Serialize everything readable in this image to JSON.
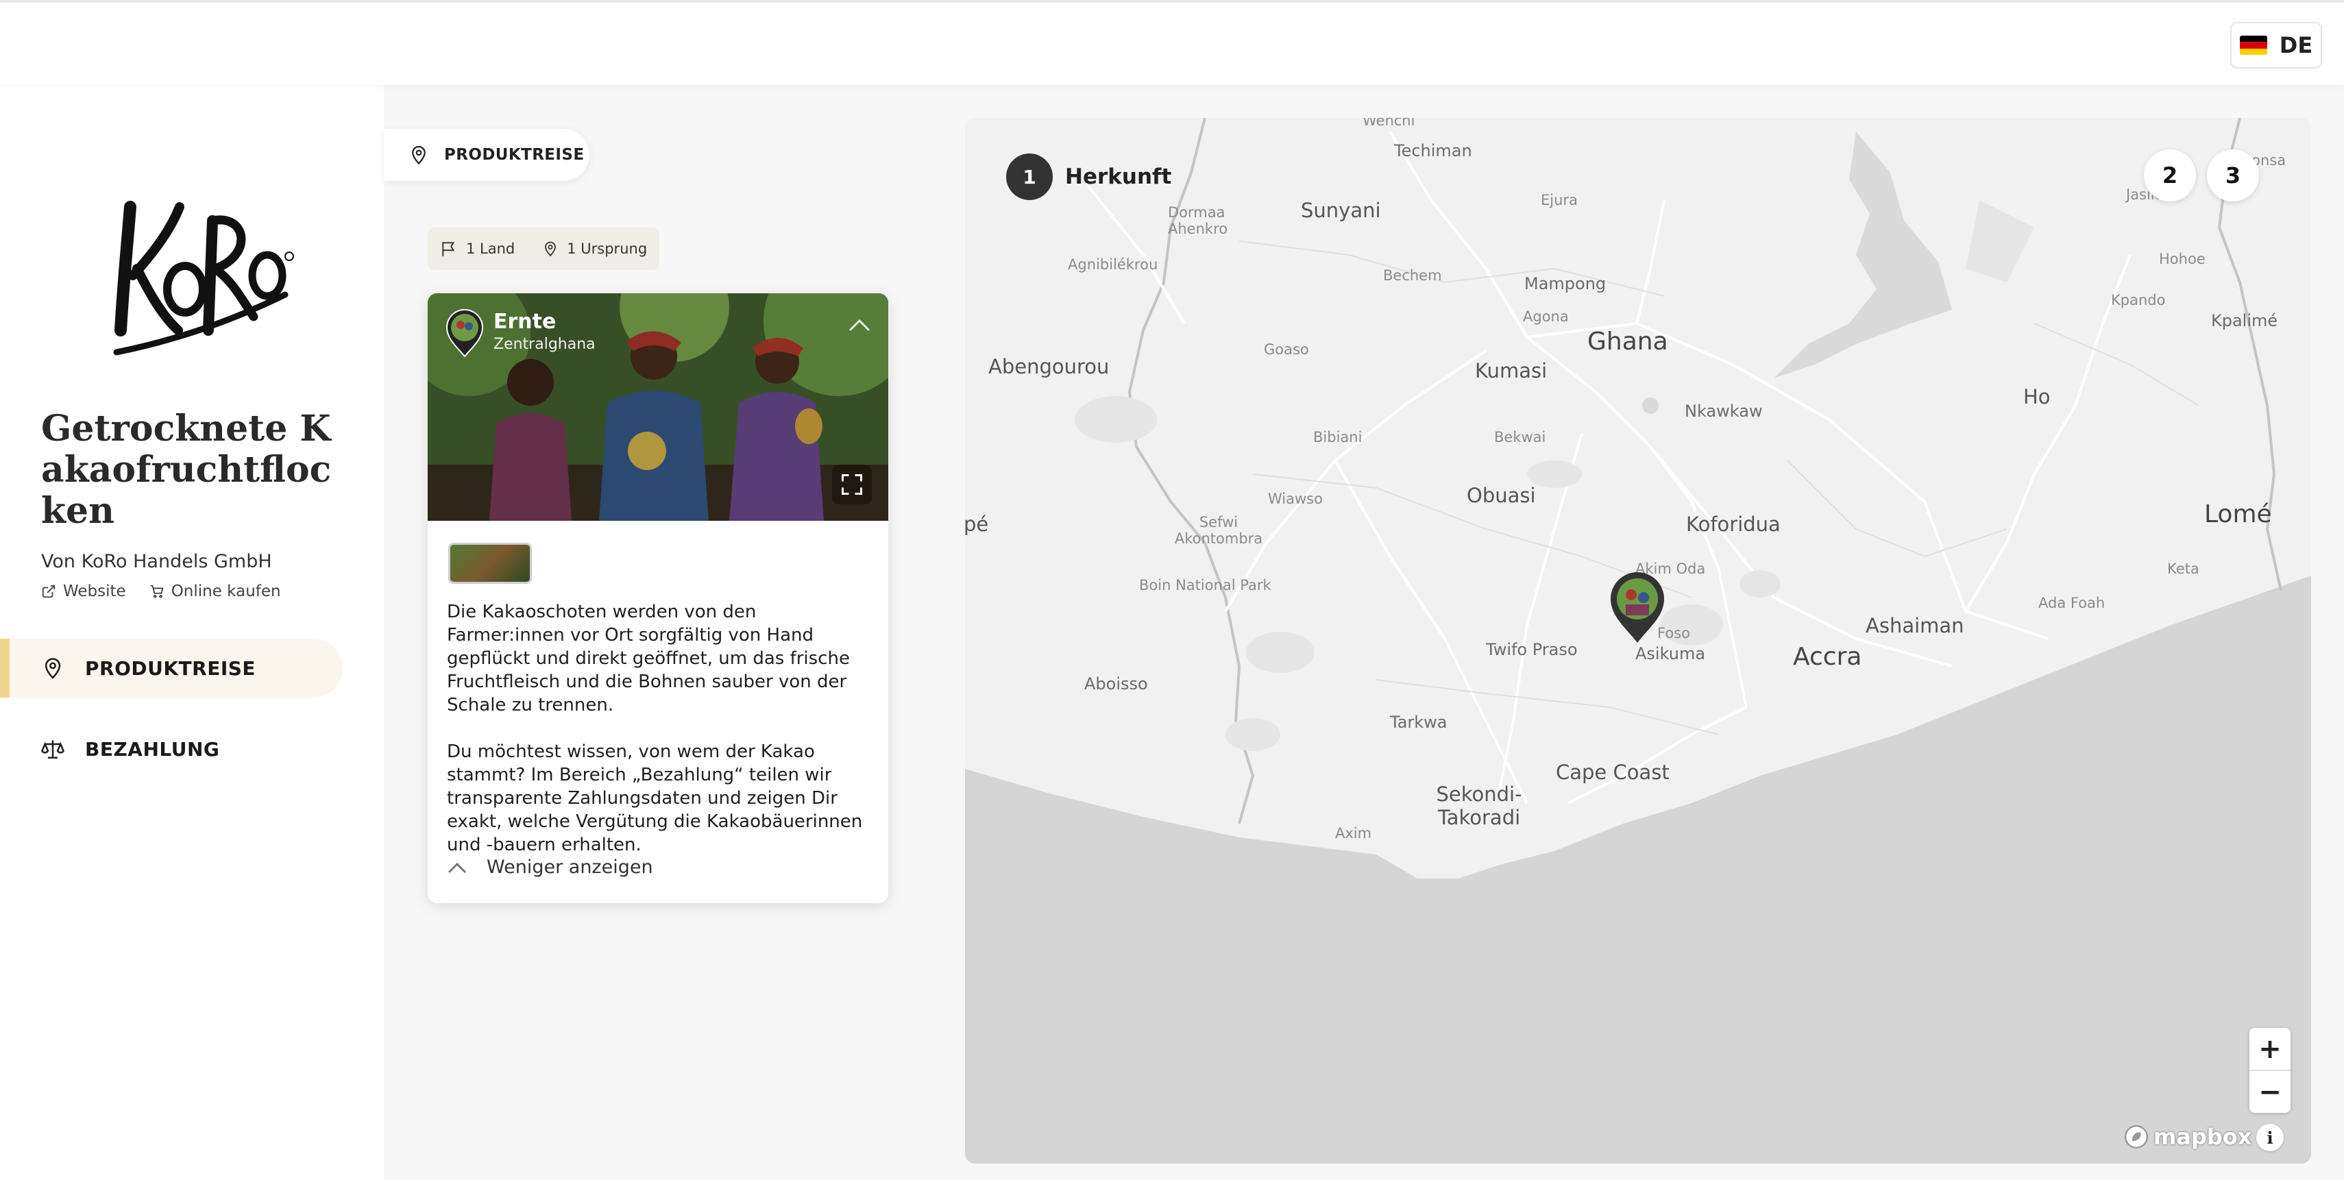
{
  "header": {
    "language": "DE",
    "flag_colors": [
      "#000000",
      "#DD0000",
      "#FFCE00"
    ]
  },
  "sidebar": {
    "logo_text": "KoRo",
    "product_title": "Getrocknete Kakaofruchtflocken",
    "company": "Von KoRo Handels GmbH",
    "links": {
      "website": "Website",
      "shop": "Online kaufen"
    },
    "nav": [
      {
        "label": "PRODUKTREISE",
        "icon": "map-pin-icon",
        "active": true
      },
      {
        "label": "BEZAHLUNG",
        "icon": "scale-icon",
        "active": false
      }
    ],
    "accent_color": "#F0D68C"
  },
  "journey": {
    "pill_label": "PRODUKTREISE",
    "chips": {
      "countries": "1 Land",
      "origins": "1 Ursprung"
    },
    "card": {
      "title": "Ernte",
      "subtitle": "Zentralghana",
      "paragraph_1": "Die Kakaoschoten werden von den Farmer:innen vor Ort sorgfältig von Hand gepflückt und direkt geöffnet,  um das frische Fruchtfleisch und die Bohnen sauber von der Schale zu trennen.",
      "paragraph_2": "Du möchtest wissen, von wem der Kakao stammt? Im Bereich „Bezahlung“ teilen wir transparente Zahlungsdaten und zeigen Dir exakt, welche Vergütung die Kakaobäuerinnen und -bauern erhalten.",
      "toggle_label": "Weniger anzeigen"
    }
  },
  "map": {
    "active_step": {
      "number": "1",
      "label": "Herkunft"
    },
    "steps": [
      "2",
      "3"
    ],
    "country_label": "Ghana",
    "places": {
      "techiman": "Techiman",
      "wenchi": "Wenchi",
      "sunyani": "Sunyani",
      "dormaa": "Dormaa Ahenkro",
      "ejura": "Ejura",
      "jasikan": "Jasikan",
      "nkonsa": "Nkonsa",
      "agnibilekrou": "Agnibilékrou",
      "bechem": "Bechem",
      "mampong": "Mampong",
      "hohoe": "Hohoe",
      "kpando": "Kpando",
      "kpalime": "Kpalimé",
      "abengourou": "Abengourou",
      "goaso": "Goaso",
      "agona": "Agona",
      "kumasi": "Kumasi",
      "nkawkaw": "Nkawkaw",
      "ho": "Ho",
      "bibiani": "Bibiani",
      "bekwai": "Bekwai",
      "obuasi": "Obuasi",
      "wiawso": "Wiawso",
      "koforidua": "Koforidua",
      "sefwi": "Sefwi Akontombra",
      "ape": "pé",
      "lome": "Lomé",
      "akim_oda": "Akim Oda",
      "keta": "Keta",
      "boin": "Boin National Park",
      "ada_foah": "Ada Foah",
      "ashaiman": "Ashaiman",
      "twifo": "Twifo Praso",
      "foso": "Foso",
      "asikuma": "Asikuma",
      "accra": "Accra",
      "aboisso": "Aboisso",
      "tarkwa": "Tarkwa",
      "cape_coast": "Cape Coast",
      "sekondi": "Sekondi-Takoradi",
      "axim": "Axim"
    },
    "zoom_in": "+",
    "zoom_out": "−",
    "attribution": "mapbox",
    "info": "i",
    "colors": {
      "land": "#F1F1F1",
      "water": "#D5D5D5",
      "lake": "#DADADA",
      "border": "#C4C4C4",
      "road": "#FFFFFF"
    }
  }
}
